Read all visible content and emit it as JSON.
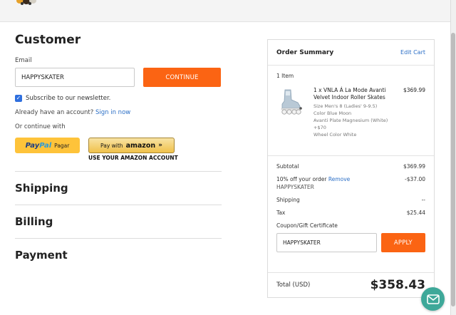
{
  "customer": {
    "heading": "Customer",
    "email_label": "Email",
    "email_value": "HAPPYSKATER",
    "continue_label": "CONTINUE",
    "newsletter_label": "Subscribe to our newsletter.",
    "account_prompt": "Already have an account?",
    "sign_in_link": "Sign in now",
    "continue_with": "Or continue with",
    "paypal": {
      "brand_part1": "Pay",
      "brand_part2": "Pal",
      "suffix": "Pagar"
    },
    "amazon": {
      "button_text": "Pay with",
      "brand": "amazon",
      "chevron": "»",
      "caption": "USE YOUR AMAZON ACCOUNT"
    }
  },
  "sections": [
    {
      "label": "Shipping"
    },
    {
      "label": "Billing"
    },
    {
      "label": "Payment"
    }
  ],
  "summary": {
    "title": "Order Summary",
    "edit_cart": "Edit Cart",
    "items_count": "1 Item",
    "item": {
      "name": "1 x VNLA Á La Mode Avanti Velvet Indoor Roller Skates",
      "price": "$369.99",
      "options": [
        "Size Men's 8 (Ladies' 9-9.5)",
        "Color Blue Moon",
        "Avanti Plate Magnesium (White) +$70",
        "Wheel Color White"
      ]
    },
    "subtotal_label": "Subtotal",
    "subtotal_value": "$369.99",
    "discount_label": "10% off your order",
    "discount_remove": "Remove",
    "discount_code": "HAPPYSKATER",
    "discount_value": "-$37.00",
    "shipping_label": "Shipping",
    "shipping_value": "--",
    "tax_label": "Tax",
    "tax_value": "$25.44",
    "coupon_label": "Coupon/Gift Certificate",
    "coupon_value": "HAPPYSKATER",
    "apply_label": "APPLY",
    "total_label": "Total (USD)",
    "total_value": "$358.43"
  },
  "icons": {
    "checkbox": "checkmark-icon",
    "chat": "chat-icon",
    "skate": "roller-skate-image"
  },
  "colors": {
    "accent_orange": "#fb6413",
    "link_blue": "#2a6ec6",
    "checkbox_blue": "#2f6fde",
    "paypal_yellow": "#fec33a",
    "chat_teal": "#3ea899"
  }
}
